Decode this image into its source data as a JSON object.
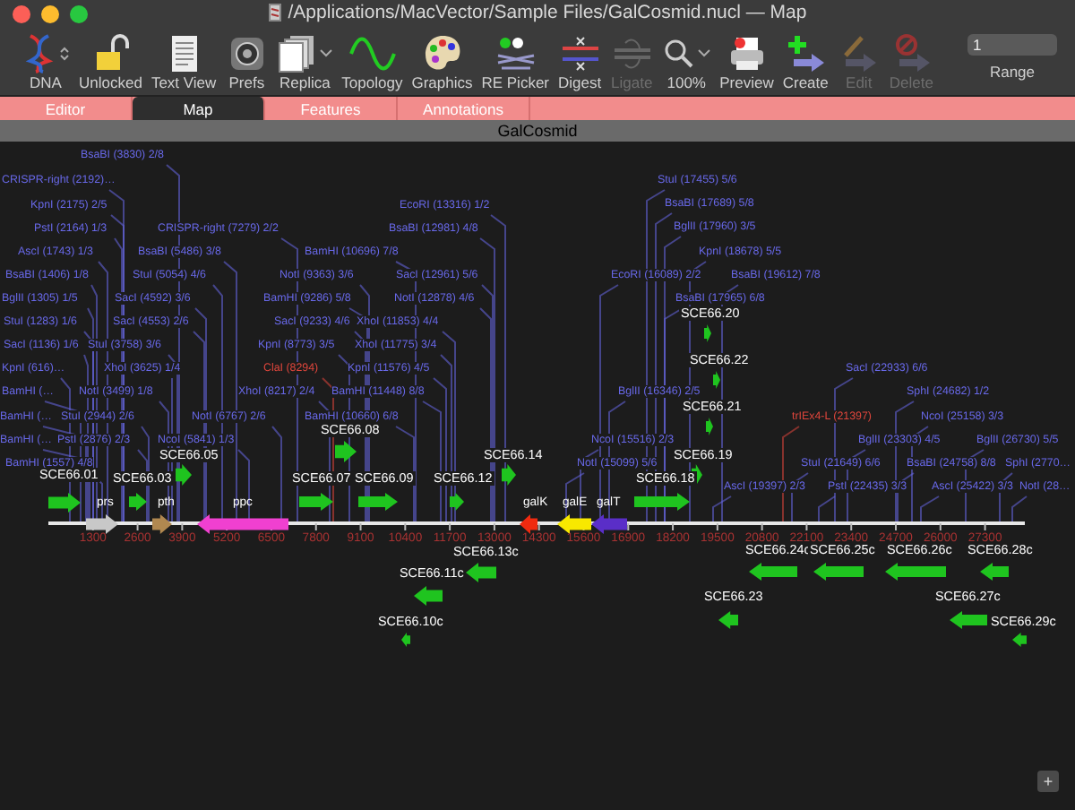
{
  "window": {
    "title": "/Applications/MacVector/Sample Files/GalCosmid.nucl — Map"
  },
  "toolbar": [
    {
      "label": "DNA",
      "disabled": false
    },
    {
      "label": "Unlocked",
      "disabled": false
    },
    {
      "label": "Text View",
      "disabled": false
    },
    {
      "label": "Prefs",
      "disabled": false
    },
    {
      "label": "Replica",
      "disabled": false
    },
    {
      "label": "Topology",
      "disabled": false
    },
    {
      "label": "Graphics",
      "disabled": false
    },
    {
      "label": "RE Picker",
      "disabled": false
    },
    {
      "label": "Digest",
      "disabled": false
    },
    {
      "label": "Ligate",
      "disabled": true
    },
    {
      "label": "100%",
      "disabled": false
    },
    {
      "label": "Preview",
      "disabled": false
    },
    {
      "label": "Create",
      "disabled": false
    },
    {
      "label": "Edit",
      "disabled": true
    },
    {
      "label": "Delete",
      "disabled": true
    }
  ],
  "range": {
    "value": "1",
    "label": "Range"
  },
  "tabs": [
    {
      "label": "Editor",
      "selected": false
    },
    {
      "label": "Map",
      "selected": true
    },
    {
      "label": "Features",
      "selected": false
    },
    {
      "label": "Annotations",
      "selected": false
    }
  ],
  "map": {
    "title": "GalCosmid",
    "sites": [
      {
        "label": "BsaBI (3830) 2/8",
        "color": "#6868e8"
      },
      {
        "label": "CRISPR-right (2192)…",
        "color": "#6868e8"
      },
      {
        "label": "StuI (17455) 5/6",
        "color": "#6868e8"
      },
      {
        "label": "KpnI (2175) 2/5",
        "color": "#6868e8"
      },
      {
        "label": "EcoRI (13316) 1/2",
        "color": "#6868e8"
      },
      {
        "label": "BsaBI (17689) 5/8",
        "color": "#6868e8"
      },
      {
        "label": "PstI (2164) 1/3",
        "color": "#6868e8"
      },
      {
        "label": "CRISPR-right (7279) 2/2",
        "color": "#6868e8"
      },
      {
        "label": "BsaBI (12981) 4/8",
        "color": "#6868e8"
      },
      {
        "label": "BglII (17960) 3/5",
        "color": "#6868e8"
      },
      {
        "label": "AscI (1743) 1/3",
        "color": "#6868e8"
      },
      {
        "label": "BsaBI (5486) 3/8",
        "color": "#6868e8"
      },
      {
        "label": "BamHI (10696) 7/8",
        "color": "#6868e8"
      },
      {
        "label": "KpnI (18678) 5/5",
        "color": "#6868e8"
      },
      {
        "label": "BsaBI (1406) 1/8",
        "color": "#6868e8"
      },
      {
        "label": "StuI (5054) 4/6",
        "color": "#6868e8"
      },
      {
        "label": "NotI (9363) 3/6",
        "color": "#6868e8"
      },
      {
        "label": "SacI (12961) 5/6",
        "color": "#6868e8"
      },
      {
        "label": "EcoRI (16089) 2/2",
        "color": "#6868e8"
      },
      {
        "label": "BsaBI (19612) 7/8",
        "color": "#6868e8"
      },
      {
        "label": "BglII (1305) 1/5",
        "color": "#6868e8"
      },
      {
        "label": "SacI (4592) 3/6",
        "color": "#6868e8"
      },
      {
        "label": "BamHI (9286) 5/8",
        "color": "#6868e8"
      },
      {
        "label": "NotI (12878) 4/6",
        "color": "#6868e8"
      },
      {
        "label": "BsaBI (17965) 6/8",
        "color": "#6868e8"
      },
      {
        "label": "StuI (1283) 1/6",
        "color": "#6868e8"
      },
      {
        "label": "SacI (4553) 2/6",
        "color": "#6868e8"
      },
      {
        "label": "SacI (9233) 4/6",
        "color": "#6868e8"
      },
      {
        "label": "XhoI (11853) 4/4",
        "color": "#6868e8"
      },
      {
        "label": "SacI (1136) 1/6",
        "color": "#6868e8"
      },
      {
        "label": "StuI (3758) 3/6",
        "color": "#6868e8"
      },
      {
        "label": "KpnI (8773) 3/5",
        "color": "#6868e8"
      },
      {
        "label": "XhoI (11775) 3/4",
        "color": "#6868e8"
      },
      {
        "label": "KpnI (616)…",
        "color": "#6868e8"
      },
      {
        "label": "XhoI (3625) 1/4",
        "color": "#6868e8"
      },
      {
        "label": "ClaI (8294)",
        "color": "#e0463c"
      },
      {
        "label": "KpnI (11576) 4/5",
        "color": "#6868e8"
      },
      {
        "label": "SacI (22933) 6/6",
        "color": "#6868e8"
      },
      {
        "label": "BamHI (…",
        "color": "#6868e8"
      },
      {
        "label": "NotI (3499) 1/8",
        "color": "#6868e8"
      },
      {
        "label": "XhoI (8217) 2/4",
        "color": "#6868e8"
      },
      {
        "label": "BamHI (11448) 8/8",
        "color": "#6868e8"
      },
      {
        "label": "BglII (16346) 2/5",
        "color": "#6868e8"
      },
      {
        "label": "SphI (24682) 1/2",
        "color": "#6868e8"
      },
      {
        "label": "BamHI (…",
        "color": "#6868e8"
      },
      {
        "label": "StuI (2944) 2/6",
        "color": "#6868e8"
      },
      {
        "label": "NotI (6767) 2/6",
        "color": "#6868e8"
      },
      {
        "label": "BamHI (10660) 6/8",
        "color": "#6868e8"
      },
      {
        "label": "trIEx4-L (21397)",
        "color": "#e0463c"
      },
      {
        "label": "NcoI (25158) 3/3",
        "color": "#6868e8"
      },
      {
        "label": "BamHI (…",
        "color": "#6868e8"
      },
      {
        "label": "PstI (2876) 2/3",
        "color": "#6868e8"
      },
      {
        "label": "NcoI (5841) 1/3",
        "color": "#6868e8"
      },
      {
        "label": "NcoI (15516) 2/3",
        "color": "#6868e8"
      },
      {
        "label": "BglII (23303) 4/5",
        "color": "#6868e8"
      },
      {
        "label": "BglII (26730) 5/5",
        "color": "#6868e8"
      },
      {
        "label": "BamHI (1557) 4/8",
        "color": "#6868e8"
      },
      {
        "label": "NotI (15099) 5/6",
        "color": "#6868e8"
      },
      {
        "label": "StuI (21649) 6/6",
        "color": "#6868e8"
      },
      {
        "label": "BsaBI (24758) 8/8",
        "color": "#6868e8"
      },
      {
        "label": "SphI (2770…",
        "color": "#6868e8"
      },
      {
        "label": "AscI (19397) 2/3",
        "color": "#6868e8"
      },
      {
        "label": "PstI (22435) 3/3",
        "color": "#6868e8"
      },
      {
        "label": "AscI (25422) 3/3",
        "color": "#6868e8"
      },
      {
        "label": "NotI (28…",
        "color": "#6868e8"
      }
    ],
    "axis_ticks": [
      "1300",
      "2600",
      "3900",
      "5200",
      "6500",
      "7800",
      "9100",
      "10400",
      "11700",
      "13000",
      "14300",
      "15600",
      "16900",
      "18200",
      "19500",
      "20800",
      "22100",
      "23400",
      "24700",
      "26000",
      "27300"
    ],
    "features": [
      {
        "label": "SCE66.20",
        "kind": "orf",
        "reverse": false,
        "color": "#1fc41f"
      },
      {
        "label": "SCE66.22",
        "kind": "orf",
        "reverse": false,
        "color": "#1fc41f"
      },
      {
        "label": "SCE66.21",
        "kind": "orf",
        "reverse": false,
        "color": "#1fc41f"
      },
      {
        "label": "SCE66.08",
        "kind": "orf",
        "reverse": false,
        "color": "#1fc41f"
      },
      {
        "label": "SCE66.05",
        "kind": "orf",
        "reverse": false,
        "color": "#1fc41f"
      },
      {
        "label": "SCE66.14",
        "kind": "orf",
        "reverse": false,
        "color": "#1fc41f"
      },
      {
        "label": "SCE66.19",
        "kind": "orf",
        "reverse": false,
        "color": "#1fc41f"
      },
      {
        "label": "SCE66.01",
        "kind": "orf",
        "reverse": false,
        "color": "#1fc41f"
      },
      {
        "label": "SCE66.03",
        "kind": "orf",
        "reverse": false,
        "color": "#1fc41f"
      },
      {
        "label": "SCE66.07",
        "kind": "orf",
        "reverse": false,
        "color": "#1fc41f"
      },
      {
        "label": "SCE66.09",
        "kind": "orf",
        "reverse": false,
        "color": "#1fc41f"
      },
      {
        "label": "SCE66.12",
        "kind": "orf",
        "reverse": false,
        "color": "#1fc41f"
      },
      {
        "label": "SCE66.18",
        "kind": "orf",
        "reverse": false,
        "color": "#1fc41f"
      },
      {
        "label": "prs",
        "kind": "gene",
        "reverse": false,
        "color": "#c8c8c8"
      },
      {
        "label": "pth",
        "kind": "gene",
        "reverse": false,
        "color": "#b08850"
      },
      {
        "label": "ppc",
        "kind": "gene",
        "reverse": true,
        "color": "#f040d0"
      },
      {
        "label": "galK",
        "kind": "gene",
        "reverse": true,
        "color": "#f02a10"
      },
      {
        "label": "galE",
        "kind": "gene",
        "reverse": true,
        "color": "#f8e800"
      },
      {
        "label": "galT",
        "kind": "gene",
        "reverse": true,
        "color": "#5a2ec8"
      },
      {
        "label": "SCE66.13c",
        "kind": "orf",
        "reverse": true,
        "color": "#1fc41f"
      },
      {
        "label": "SCE66.24c",
        "kind": "orf",
        "reverse": true,
        "color": "#1fc41f"
      },
      {
        "label": "SCE66.25c",
        "kind": "orf",
        "reverse": true,
        "color": "#1fc41f"
      },
      {
        "label": "SCE66.26c",
        "kind": "orf",
        "reverse": true,
        "color": "#1fc41f"
      },
      {
        "label": "SCE66.28c",
        "kind": "orf",
        "reverse": true,
        "color": "#1fc41f"
      },
      {
        "label": "SCE66.11c",
        "kind": "orf",
        "reverse": true,
        "color": "#1fc41f"
      },
      {
        "label": "SCE66.23",
        "kind": "orf",
        "reverse": true,
        "color": "#1fc41f"
      },
      {
        "label": "SCE66.27c",
        "kind": "orf",
        "reverse": true,
        "color": "#1fc41f"
      },
      {
        "label": "SCE66.10c",
        "kind": "orf",
        "reverse": true,
        "color": "#1fc41f"
      },
      {
        "label": "SCE66.29c",
        "kind": "orf",
        "reverse": true,
        "color": "#1fc41f"
      }
    ]
  },
  "corner_button": "+"
}
